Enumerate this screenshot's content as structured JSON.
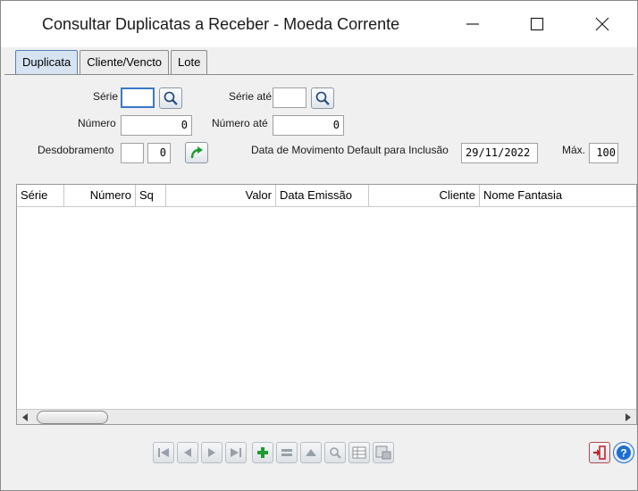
{
  "window": {
    "title": "Consultar Duplicatas a Receber - Moeda Corrente",
    "controls": [
      "minimize-icon",
      "maximize-icon",
      "close-icon"
    ]
  },
  "tabs": [
    {
      "label": "Duplicata",
      "active": true
    },
    {
      "label": "Cliente/Vencto",
      "active": false
    },
    {
      "label": "Lote",
      "active": false
    }
  ],
  "form": {
    "serie_label": "Série",
    "serie_value": "",
    "serie_ate_label": "Série até",
    "serie_ate_value": "",
    "numero_label": "Número",
    "numero_value": "0",
    "numero_ate_label": "Número até",
    "numero_ate_value": "0",
    "desdobramento_label": "Desdobramento",
    "desdobramento_value1": "",
    "desdobramento_value2": "0",
    "data_mov_label": "Data de Movimento Default para Inclusão",
    "data_mov_value": "29/11/2022",
    "max_label": "Máx.",
    "max_value": "100"
  },
  "grid": {
    "columns": [
      "Série",
      "Número",
      "Sq",
      "Valor",
      "Data Emissão",
      "Cliente",
      "Nome Fantasia"
    ],
    "rows": []
  },
  "toolbar": {
    "icons": [
      "first-icon",
      "previous-icon",
      "next-icon",
      "last-icon",
      "add-icon",
      "edit-icon",
      "up-icon",
      "search-icon",
      "grid-icon",
      "export-icon"
    ],
    "right_icons": [
      "exit-icon",
      "help-icon"
    ]
  },
  "colors": {
    "accent": "#3a78c9",
    "add_green": "#1e9a2e",
    "exit_red": "#c0262d",
    "help_blue": "#1b6fd1"
  }
}
